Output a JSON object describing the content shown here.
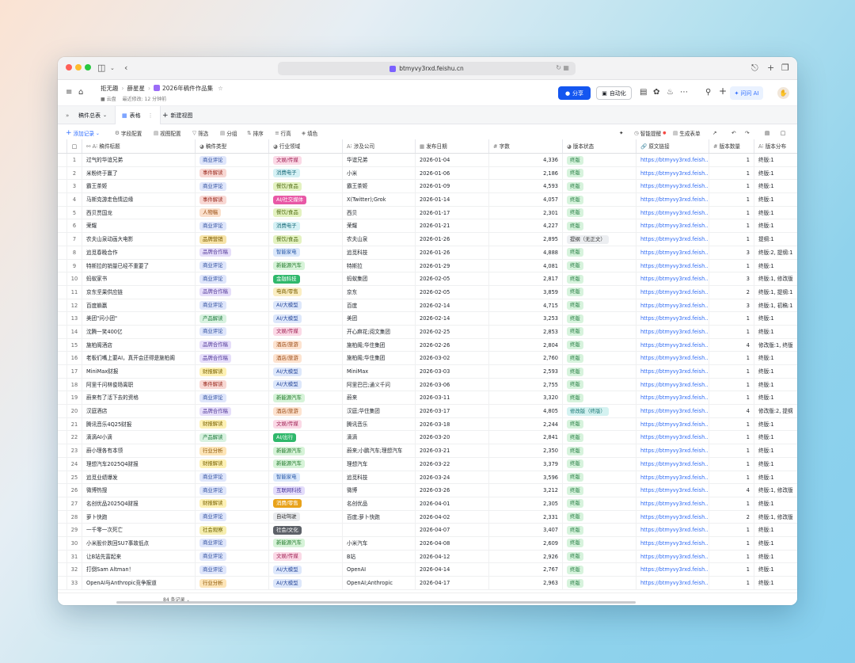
{
  "browser": {
    "url": "btmyvy3rxd.feishu.cn"
  },
  "app": {
    "breadcrumb": [
      "拒无趣",
      "薛星星",
      "2026年稿件作品集"
    ],
    "location": "云盘",
    "last_modified": "最近修改: 12 分钟前",
    "share_label": "分享",
    "automation_label": "自动化",
    "ai_label": "问问 AI"
  },
  "tabs": {
    "table_group": "稿件总表",
    "active_view": "表格",
    "new_view": "新建视图"
  },
  "toolbar": {
    "add_record": "添加记录",
    "field_config": "字段配置",
    "view_config": "视图配置",
    "filter": "筛选",
    "group": "分组",
    "sort": "排序",
    "row_height": "行高",
    "fill_color": "填色",
    "smart_reminder": "智能提醒",
    "generate_form": "生成表单"
  },
  "columns": [
    "稿件标题",
    "稿件类型",
    "行业领域",
    "涉及公司",
    "发布日期",
    "字数",
    "版本状态",
    "原文链接",
    "版本数量",
    "版本分布"
  ],
  "tag_colors": {
    "商业评论": [
      "#dfe6fb",
      "#2b4b9c"
    ],
    "事件解读": [
      "#f8d8d4",
      "#9b2c20"
    ],
    "人物稿": [
      "#fbe0cc",
      "#9a4e12"
    ],
    "品牌营销": [
      "#f6e3a8",
      "#7a5a00"
    ],
    "品牌合作稿": [
      "#e6defa",
      "#553c9a"
    ],
    "产品解读": [
      "#d8f2e0",
      "#1f7a3d"
    ],
    "财报解读": [
      "#fdf1b4",
      "#7a6200"
    ],
    "行业分析": [
      "#fde5b8",
      "#8a5300"
    ],
    "社会观察": [
      "#f6eeb0",
      "#6f6100"
    ],
    "文娱/传媒": [
      "#fbd9e6",
      "#a3285a"
    ],
    "消费电子": [
      "#d5f1f5",
      "#1a6c7a"
    ],
    "餐饮/食品": [
      "#e3f2c0",
      "#4d6a12"
    ],
    "AI/社交媒体": [
      "#e858a6",
      "#ffffff"
    ],
    "智能家电": [
      "#dbe8fb",
      "#2a5aa8"
    ],
    "新能源汽车": [
      "#d6f3d8",
      "#237a2c"
    ],
    "金融科技": [
      "#2fb86b",
      "#ffffff"
    ],
    "电商/零售": [
      "#fbeec2",
      "#7c6100"
    ],
    "AI/大模型": [
      "#dde7fb",
      "#2b4b9c"
    ],
    "酒店/旅游": [
      "#fde3d0",
      "#9a4a14"
    ],
    "AI/出行": [
      "#2fb86b",
      "#ffffff"
    ],
    "互联网科技": [
      "#e3dcfb",
      "#4e3a9e"
    ],
    "消费/零售": [
      "#e8a21a",
      "#ffffff"
    ],
    "自动驾驶": [
      "#e8eaed",
      "#333333"
    ],
    "社会/文化": [
      "#5d6168",
      "#ffffff"
    ],
    "终版": [
      "#d7f3dd",
      "#1f7a3d"
    ],
    "提纲（无正文）": [
      "#eceef1",
      "#333333"
    ],
    "修改版（终版）": [
      "#d4f2f1",
      "#137470"
    ]
  },
  "rows": [
    {
      "n": "1",
      "title": "过气的华谊兄弟",
      "type": "商业评论",
      "industry": "文娱/传媒",
      "company": "华谊兄弟",
      "date": "2026-01-04",
      "words": "4,336",
      "status": "终版",
      "link": "https://btmyvy3rxd.feish...",
      "count": "1",
      "dist": "终版:1"
    },
    {
      "n": "2",
      "title": "米粉终于赢了",
      "type": "事件解读",
      "industry": "消费电子",
      "company": "小米",
      "date": "2026-01-06",
      "words": "2,186",
      "status": "终版",
      "link": "https://btmyvy3rxd.feish...",
      "count": "1",
      "dist": "终版:1"
    },
    {
      "n": "3",
      "title": "霸王茶姬",
      "type": "商业评论",
      "industry": "餐饮/食品",
      "company": "霸王茶姬",
      "date": "2026-01-09",
      "words": "4,593",
      "status": "终版",
      "link": "https://btmyvy3rxd.feish...",
      "count": "1",
      "dist": "终版:1"
    },
    {
      "n": "4",
      "title": "马斯克游走色情边缘",
      "type": "事件解读",
      "industry": "AI/社交媒体",
      "company": "X(Twitter);Grok",
      "date": "2026-01-14",
      "words": "4,057",
      "status": "终版",
      "link": "https://btmyvy3rxd.feish...",
      "count": "1",
      "dist": "终版:1"
    },
    {
      "n": "5",
      "title": "西贝贾国龙",
      "type": "人物稿",
      "industry": "餐饮/食品",
      "company": "西贝",
      "date": "2026-01-17",
      "words": "2,301",
      "status": "终版",
      "link": "https://btmyvy3rxd.feish...",
      "count": "1",
      "dist": "终版:1"
    },
    {
      "n": "6",
      "title": "荣耀",
      "type": "商业评论",
      "industry": "消费电子",
      "company": "荣耀",
      "date": "2026-01-21",
      "words": "4,227",
      "status": "终版",
      "link": "https://btmyvy3rxd.feish...",
      "count": "1",
      "dist": "终版:1"
    },
    {
      "n": "7",
      "title": "农夫山泉动画大电影",
      "type": "品牌营销",
      "industry": "餐饮/食品",
      "company": "农夫山泉",
      "date": "2026-01-26",
      "words": "2,895",
      "status": "提纲（无正文）",
      "link": "https://btmyvy3rxd.feish...",
      "count": "1",
      "dist": "提纲:1"
    },
    {
      "n": "8",
      "title": "追觅春晚合作",
      "type": "品牌合作稿",
      "industry": "智能家电",
      "company": "追觅科技",
      "date": "2026-01-26",
      "words": "4,888",
      "status": "终版",
      "link": "https://btmyvy3rxd.feish...",
      "count": "3",
      "dist": "终版:2, 提纲:1"
    },
    {
      "n": "9",
      "title": "特斯拉的销量已经不重要了",
      "type": "商业评论",
      "industry": "新能源汽车",
      "company": "特斯拉",
      "date": "2026-01-29",
      "words": "4,081",
      "status": "终版",
      "link": "https://btmyvy3rxd.feish...",
      "count": "1",
      "dist": "终版:1"
    },
    {
      "n": "10",
      "title": "蚂蚁家书",
      "type": "商业评论",
      "industry": "金融科技",
      "company": "蚂蚁集团",
      "date": "2026-02-05",
      "words": "2,817",
      "status": "终版",
      "link": "https://btmyvy3rxd.feish...",
      "count": "3",
      "dist": "终版:1, 修改版"
    },
    {
      "n": "11",
      "title": "京东坚果供应链",
      "type": "品牌合作稿",
      "industry": "电商/零售",
      "company": "京东",
      "date": "2026-02-05",
      "words": "3,859",
      "status": "终版",
      "link": "https://btmyvy3rxd.feish...",
      "count": "2",
      "dist": "终版:1, 提纲:1"
    },
    {
      "n": "12",
      "title": "百度躺赢",
      "type": "商业评论",
      "industry": "AI/大模型",
      "company": "百度",
      "date": "2026-02-14",
      "words": "4,715",
      "status": "终版",
      "link": "https://btmyvy3rxd.feish...",
      "count": "3",
      "dist": "终版:1, 初稿:1"
    },
    {
      "n": "13",
      "title": "美团\"问小团\"",
      "type": "产品解读",
      "industry": "AI/大模型",
      "company": "美团",
      "date": "2026-02-14",
      "words": "3,253",
      "status": "终版",
      "link": "https://btmyvy3rxd.feish...",
      "count": "1",
      "dist": "终版:1"
    },
    {
      "n": "14",
      "title": "沈腾一笑400亿",
      "type": "商业评论",
      "industry": "文娱/传媒",
      "company": "开心麻花;阅文集团",
      "date": "2026-02-25",
      "words": "2,853",
      "status": "终版",
      "link": "https://btmyvy3rxd.feish...",
      "count": "1",
      "dist": "终版:1"
    },
    {
      "n": "15",
      "title": "施柏阁酒店",
      "type": "品牌合作稿",
      "industry": "酒店/旅游",
      "company": "施柏阁;华住集团",
      "date": "2026-02-26",
      "words": "2,804",
      "status": "终版",
      "link": "https://btmyvy3rxd.feish...",
      "count": "4",
      "dist": "修改版:1, 终版"
    },
    {
      "n": "16",
      "title": "老板们嘴上要AI，真开会还得是施柏阁",
      "type": "品牌合作稿",
      "industry": "酒店/旅游",
      "company": "施柏阁;华住集团",
      "date": "2026-03-02",
      "words": "2,760",
      "status": "终版",
      "link": "https://btmyvy3rxd.feish...",
      "count": "1",
      "dist": "终版:1"
    },
    {
      "n": "17",
      "title": "MiniMax财报",
      "type": "财报解读",
      "industry": "AI/大模型",
      "company": "MiniMax",
      "date": "2026-03-03",
      "words": "2,593",
      "status": "终版",
      "link": "https://btmyvy3rxd.feish...",
      "count": "1",
      "dist": "终版:1"
    },
    {
      "n": "18",
      "title": "阿里千问林俊旸离职",
      "type": "事件解读",
      "industry": "AI/大模型",
      "company": "阿里巴巴;通义千问",
      "date": "2026-03-06",
      "words": "2,755",
      "status": "终版",
      "link": "https://btmyvy3rxd.feish...",
      "count": "1",
      "dist": "终版:1"
    },
    {
      "n": "19",
      "title": "蔚来有了活下去的资格",
      "type": "商业评论",
      "industry": "新能源汽车",
      "company": "蔚来",
      "date": "2026-03-11",
      "words": "3,320",
      "status": "终版",
      "link": "https://btmyvy3rxd.feish...",
      "count": "1",
      "dist": "终版:1"
    },
    {
      "n": "20",
      "title": "汉庭酒店",
      "type": "品牌合作稿",
      "industry": "酒店/旅游",
      "company": "汉庭;华住集团",
      "date": "2026-03-17",
      "words": "4,805",
      "status": "修改版（终版）",
      "link": "https://btmyvy3rxd.feish...",
      "count": "4",
      "dist": "修改版:2, 提纲"
    },
    {
      "n": "21",
      "title": "腾讯音乐4Q25财报",
      "type": "财报解读",
      "industry": "文娱/传媒",
      "company": "腾讯音乐",
      "date": "2026-03-18",
      "words": "2,244",
      "status": "终版",
      "link": "https://btmyvy3rxd.feish...",
      "count": "1",
      "dist": "终版:1"
    },
    {
      "n": "22",
      "title": "滴滴AI小滴",
      "type": "产品解读",
      "industry": "AI/出行",
      "company": "滴滴",
      "date": "2026-03-20",
      "words": "2,841",
      "status": "终版",
      "link": "https://btmyvy3rxd.feish...",
      "count": "1",
      "dist": "终版:1"
    },
    {
      "n": "23",
      "title": "蔚小理各有本领",
      "type": "行业分析",
      "industry": "新能源汽车",
      "company": "蔚来;小鹏汽车;理想汽车",
      "date": "2026-03-21",
      "words": "2,350",
      "status": "终版",
      "link": "https://btmyvy3rxd.feish...",
      "count": "1",
      "dist": "终版:1"
    },
    {
      "n": "24",
      "title": "理想汽车2025Q4财报",
      "type": "财报解读",
      "industry": "新能源汽车",
      "company": "理想汽车",
      "date": "2026-03-22",
      "words": "3,379",
      "status": "终版",
      "link": "https://btmyvy3rxd.feish...",
      "count": "1",
      "dist": "终版:1"
    },
    {
      "n": "25",
      "title": "追觅业绩爆发",
      "type": "商业评论",
      "industry": "智能家电",
      "company": "追觅科技",
      "date": "2026-03-24",
      "words": "3,596",
      "status": "终版",
      "link": "https://btmyvy3rxd.feish...",
      "count": "1",
      "dist": "终版:1"
    },
    {
      "n": "26",
      "title": "微博热搜",
      "type": "商业评论",
      "industry": "互联网科技",
      "company": "微博",
      "date": "2026-03-26",
      "words": "3,212",
      "status": "终版",
      "link": "https://btmyvy3rxd.feish...",
      "count": "4",
      "dist": "终版:1, 修改版"
    },
    {
      "n": "27",
      "title": "名创优品2025Q4财报",
      "type": "财报解读",
      "industry": "消费/零售",
      "company": "名创优品",
      "date": "2026-04-01",
      "words": "2,305",
      "status": "终版",
      "link": "https://btmyvy3rxd.feish...",
      "count": "1",
      "dist": "终版:1"
    },
    {
      "n": "28",
      "title": "萝卜快跑",
      "type": "商业评论",
      "industry": "自动驾驶",
      "company": "百度;萝卜快跑",
      "date": "2026-04-02",
      "words": "2,331",
      "status": "终版",
      "link": "https://btmyvy3rxd.feish...",
      "count": "2",
      "dist": "终版:1, 修改版"
    },
    {
      "n": "29",
      "title": "一千零一次死亡",
      "type": "社会观察",
      "industry": "社会/文化",
      "company": "",
      "date": "2026-04-07",
      "words": "3,407",
      "status": "终版",
      "link": "https://btmyvy3rxd.feish...",
      "count": "1",
      "dist": "终版:1"
    },
    {
      "n": "30",
      "title": "小米股价跌回SU7事故低点",
      "type": "商业评论",
      "industry": "新能源汽车",
      "company": "小米汽车",
      "date": "2026-04-08",
      "words": "2,609",
      "status": "终版",
      "link": "https://btmyvy3rxd.feish...",
      "count": "1",
      "dist": "终版:1"
    },
    {
      "n": "31",
      "title": "让B站先富起来",
      "type": "商业评论",
      "industry": "文娱/传媒",
      "company": "B站",
      "date": "2026-04-12",
      "words": "2,926",
      "status": "终版",
      "link": "https://btmyvy3rxd.feish...",
      "count": "1",
      "dist": "终版:1"
    },
    {
      "n": "32",
      "title": "打倒Sam Altman！",
      "type": "商业评论",
      "industry": "AI/大模型",
      "company": "OpenAI",
      "date": "2026-04-14",
      "words": "2,767",
      "status": "终版",
      "link": "https://btmyvy3rxd.feish...",
      "count": "1",
      "dist": "终版:1"
    },
    {
      "n": "33",
      "title": "OpenAI与Anthropic竞争报道",
      "type": "行业分析",
      "industry": "AI/大模型",
      "company": "OpenAI;Anthropic",
      "date": "2026-04-17",
      "words": "2,963",
      "status": "终版",
      "link": "https://btmyvy3rxd.feish...",
      "count": "1",
      "dist": "终版:1"
    }
  ],
  "footer": {
    "record_count": "84 条记录"
  }
}
